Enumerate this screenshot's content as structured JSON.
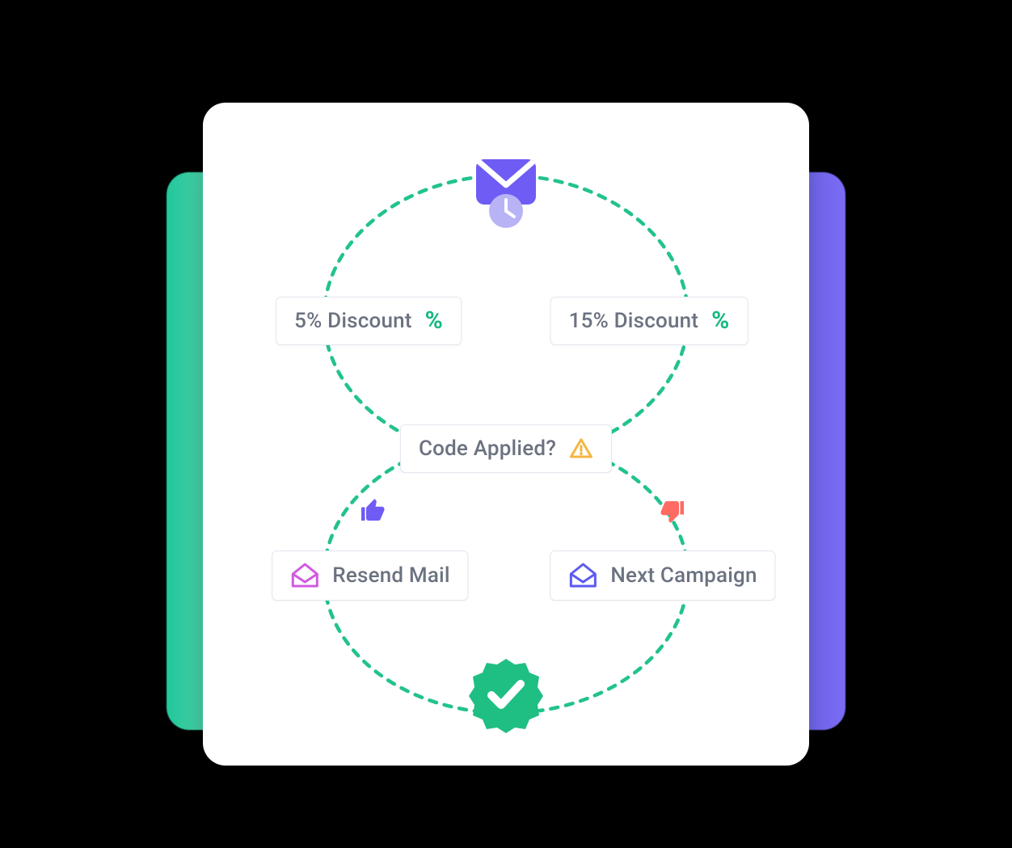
{
  "flow": {
    "top_icon": "scheduled-envelope-icon",
    "option_a": {
      "label": "5% Discount"
    },
    "option_b": {
      "label": "15% Discount"
    },
    "condition": {
      "label": "Code Applied?"
    },
    "yes_action": {
      "label": "Resend Mail"
    },
    "no_action": {
      "label": "Next Campaign"
    },
    "end_icon": "verified-checkmark-icon"
  },
  "colors": {
    "accent_green": "#18b981",
    "dash_green": "#22c28f",
    "thumb_blue": "#6e5cf5",
    "thumb_red": "#ff6b63",
    "warn": "#f5b541",
    "mail_pink": "#d05be0",
    "mail_blue": "#5b5bf0",
    "badge_green": "#1fbf83",
    "text_gray": "#6b7280"
  }
}
